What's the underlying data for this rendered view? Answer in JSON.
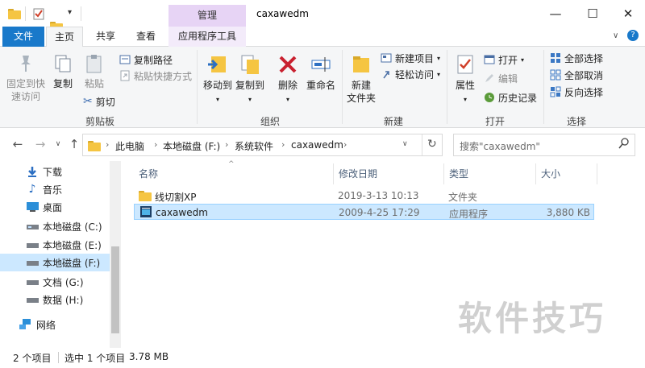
{
  "window": {
    "title": "caxawedm",
    "context_tab": "管理",
    "controls": {
      "minimize": "—",
      "maximize": "☐",
      "close": "✕"
    }
  },
  "tabs": {
    "file": "文件",
    "home": "主页",
    "share": "共享",
    "view": "查看",
    "app_tools": "应用程序工具"
  },
  "ribbon": {
    "clipboard": {
      "label": "剪贴板",
      "pin_line1": "固定到快",
      "pin_line2": "速访问",
      "copy": "复制",
      "paste": "粘贴",
      "copy_path": "复制路径",
      "paste_shortcut": "粘贴快捷方式",
      "cut": "剪切"
    },
    "organize": {
      "label": "组织",
      "move_to": "移动到",
      "copy_to": "复制到",
      "delete": "删除",
      "rename": "重命名"
    },
    "new": {
      "label": "新建",
      "new_folder_line1": "新建",
      "new_folder_line2": "文件夹",
      "new_item": "新建项目",
      "easy_access": "轻松访问"
    },
    "open": {
      "label": "打开",
      "properties": "属性",
      "open": "打开",
      "edit": "编辑",
      "history": "历史记录"
    },
    "select": {
      "label": "选择",
      "select_all": "全部选择",
      "select_none": "全部取消",
      "invert": "反向选择"
    }
  },
  "address": {
    "crumbs": [
      "此电脑",
      "本地磁盘 (F:)",
      "系统软件",
      "caxawedm"
    ],
    "search_placeholder": "搜索\"caxawedm\""
  },
  "nav": {
    "items": [
      {
        "label": "下载",
        "icon": "download-icon"
      },
      {
        "label": "音乐",
        "icon": "music-icon"
      },
      {
        "label": "桌面",
        "icon": "desktop-icon"
      },
      {
        "label": "本地磁盘 (C:)",
        "icon": "drive-icon"
      },
      {
        "label": "本地磁盘 (E:)",
        "icon": "drive-icon"
      },
      {
        "label": "本地磁盘 (F:)",
        "icon": "drive-icon",
        "selected": true
      },
      {
        "label": "文档 (G:)",
        "icon": "drive-icon"
      },
      {
        "label": "数据 (H:)",
        "icon": "drive-icon"
      },
      {
        "label": "网络",
        "icon": "network-icon"
      }
    ]
  },
  "list": {
    "columns": [
      "名称",
      "修改日期",
      "类型",
      "大小"
    ],
    "rows": [
      {
        "name": "线切割XP",
        "date": "2019-3-13 10:13",
        "type": "文件夹",
        "size": "",
        "icon": "folder-icon"
      },
      {
        "name": "caxawedm",
        "date": "2009-4-25 17:29",
        "type": "应用程序",
        "size": "3,880 KB",
        "icon": "app-icon",
        "selected": true
      }
    ]
  },
  "status": {
    "count": "2 个项目",
    "selection": "选中 1 个项目",
    "size": "3.78 MB"
  },
  "watermark": "软件技巧",
  "colors": {
    "file_tab": "#1979ca",
    "context_tab": "#e7d4f5",
    "selection": "#cce8ff",
    "column_header_text": "#4c607a"
  }
}
